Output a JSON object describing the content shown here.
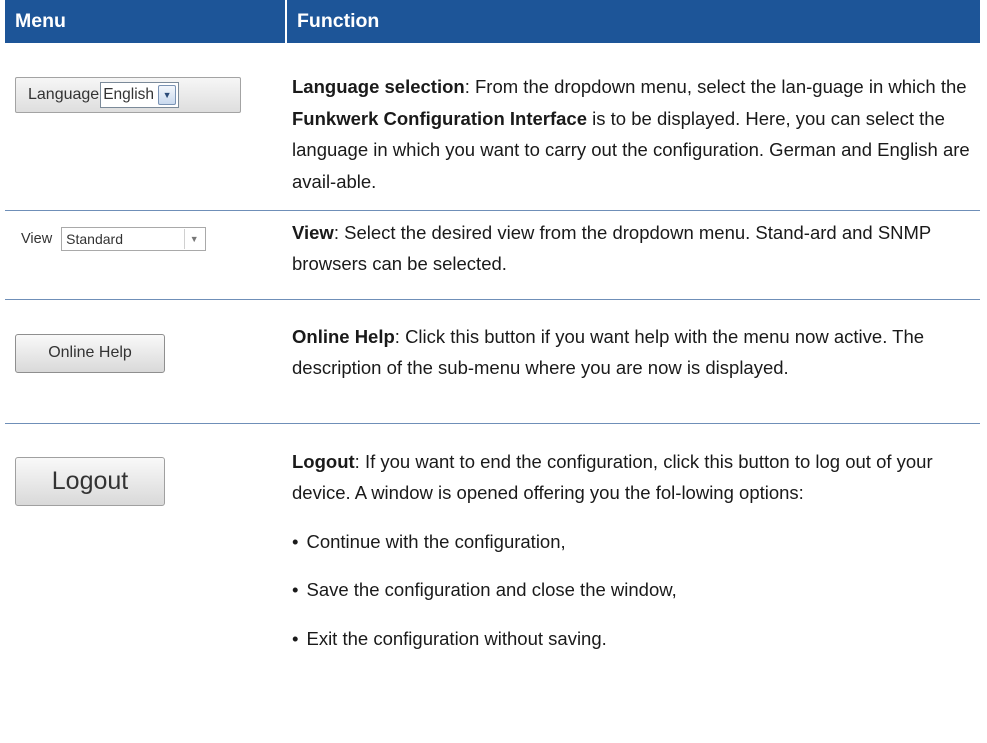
{
  "header": {
    "menu": "Menu",
    "function": "Function"
  },
  "rows": {
    "language": {
      "widget_label": "Language",
      "widget_value": "English",
      "title": "Language selection",
      "text": ": From the dropdown menu, select the lan-guage in which the ",
      "bold2": "Funkwerk Configuration Interface",
      "text2": "  is to be displayed. Here, you can select the language in which you want to carry out the configuration. German and English are avail-able."
    },
    "view": {
      "widget_label": "View",
      "widget_value": "Standard",
      "title": "View",
      "text": ": Select the desired view from the dropdown menu. Stand-ard and SNMP browsers can be selected."
    },
    "help": {
      "button_label": "Online Help",
      "title": "Online Help",
      "text": ": Click this button if you want help with the menu now active. The description of the sub-menu where you are now is displayed."
    },
    "logout": {
      "button_label": "Logout",
      "title": "Logout",
      "text": ": If you want to end the configuration, click this button to log out of your device. A window is opened offering you the fol-lowing options:",
      "options": [
        "Continue with the configuration,",
        "Save the configuration and close the window,",
        "Exit the configuration without saving."
      ]
    }
  }
}
